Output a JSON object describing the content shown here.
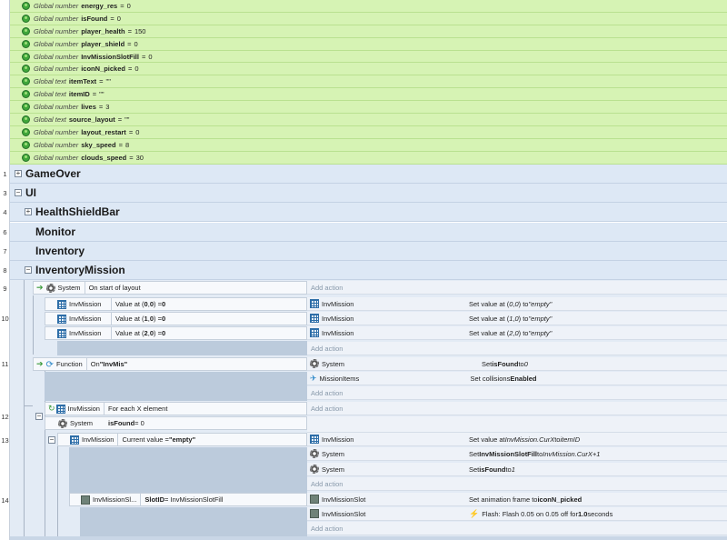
{
  "globals": [
    {
      "kind": "Global number",
      "name": "energy_res",
      "op": "=",
      "value": "0"
    },
    {
      "kind": "Global number",
      "name": "isFound",
      "op": "=",
      "value": "0"
    },
    {
      "kind": "Global number",
      "name": "player_health",
      "op": "=",
      "value": "150"
    },
    {
      "kind": "Global number",
      "name": "player_shield",
      "op": "=",
      "value": "0"
    },
    {
      "kind": "Global number",
      "name": "InvMissionSlotFill",
      "op": "=",
      "value": "0"
    },
    {
      "kind": "Global number",
      "name": "iconN_picked",
      "op": "=",
      "value": "0"
    },
    {
      "kind": "Global text",
      "name": "itemText",
      "op": "=",
      "value": "\"\""
    },
    {
      "kind": "Global text",
      "name": "itemID",
      "op": "=",
      "value": "\"\""
    },
    {
      "kind": "Global number",
      "name": "lives",
      "op": "=",
      "value": "3"
    },
    {
      "kind": "Global text",
      "name": "source_layout",
      "op": "=",
      "value": "\"\""
    },
    {
      "kind": "Global number",
      "name": "layout_restart",
      "op": "=",
      "value": "0"
    },
    {
      "kind": "Global number",
      "name": "sky_speed",
      "op": "=",
      "value": "8"
    },
    {
      "kind": "Global number",
      "name": "clouds_speed",
      "op": "=",
      "value": "30"
    }
  ],
  "line_numbers": [
    "1",
    "3",
    "4",
    "6",
    "7",
    "8",
    "9",
    "10",
    "11",
    "12",
    "13",
    "14"
  ],
  "groups": {
    "gameover": "GameOver",
    "ui": "UI",
    "healthshieldbar": "HealthShieldBar",
    "monitor": "Monitor",
    "inventory": "Inventory",
    "inventorymission": "InventoryMission"
  },
  "expanders": {
    "plus": "+",
    "minus": "−"
  },
  "add_action": "Add action",
  "ev9": {
    "object": "System",
    "condition": "On start of layout"
  },
  "ev10": {
    "rows": [
      {
        "obj": "InvMission",
        "cond_a": "Value at (",
        "x": "0",
        "mid": ", ",
        "y": "0",
        "cond_b": ") = ",
        "val": "0",
        "act_obj": "InvMission",
        "act_a": "Set value at (",
        "ax": "0",
        "amid": ", ",
        "ay": "0",
        "act_b": ") to ",
        "aval": "\"empty\""
      },
      {
        "obj": "InvMission",
        "cond_a": "Value at (",
        "x": "1",
        "mid": ", ",
        "y": "0",
        "cond_b": ") = ",
        "val": "0",
        "act_obj": "InvMission",
        "act_a": "Set value at (",
        "ax": "1",
        "amid": ", ",
        "ay": "0",
        "act_b": ") to ",
        "aval": "\"empty\""
      },
      {
        "obj": "InvMission",
        "cond_a": "Value at (",
        "x": "2",
        "mid": ", ",
        "y": "0",
        "cond_b": ") = ",
        "val": "0",
        "act_obj": "InvMission",
        "act_a": "Set value at (",
        "ax": "2",
        "amid": ", ",
        "ay": "0",
        "act_b": ") to ",
        "aval": "\"empty\""
      }
    ]
  },
  "ev11": {
    "object": "Function",
    "cond_a": "On ",
    "cond_name": "\"InvMis\"",
    "a1_obj": "System",
    "a1_a": "Set ",
    "a1_var": "isFound",
    "a1_b": " to ",
    "a1_val": "0",
    "a2_obj": "MissionItems",
    "a2_a": "Set collisions ",
    "a2_val": "Enabled"
  },
  "ev12": {
    "c1_obj": "InvMission",
    "c1_text": "For each X element",
    "c2_obj": "System",
    "c2_var": "isFound",
    "c2_rest": " = 0"
  },
  "ev13": {
    "obj": "InvMission",
    "cond_a": "Current value = ",
    "cond_val": "\"empty\"",
    "a1_obj": "InvMission",
    "a1_a": "Set value at ",
    "a1_x": "InvMission.CurX",
    "a1_b": " to ",
    "a1_v": "itemID",
    "a2_obj": "System",
    "a2_a": "Set ",
    "a2_var": "InvMissionSlotFill",
    "a2_b": " to ",
    "a2_v": "InvMission.CurX+1",
    "a3_obj": "System",
    "a3_a": "Set ",
    "a3_var": "isFound",
    "a3_b": " to ",
    "a3_v": "1"
  },
  "ev14": {
    "obj": "InvMissionSl...",
    "cond_var": "SlotID",
    "cond_rest": " = InvMissionSlotFill",
    "a1_obj": "InvMissionSlot",
    "a1_a": "Set animation frame to ",
    "a1_v": "iconN_picked",
    "a2_obj": "InvMissionSlot",
    "a2_a": "Flash: Flash 0.05 on 0.05 off for ",
    "a2_v": "1.0",
    "a2_b": " seconds"
  }
}
